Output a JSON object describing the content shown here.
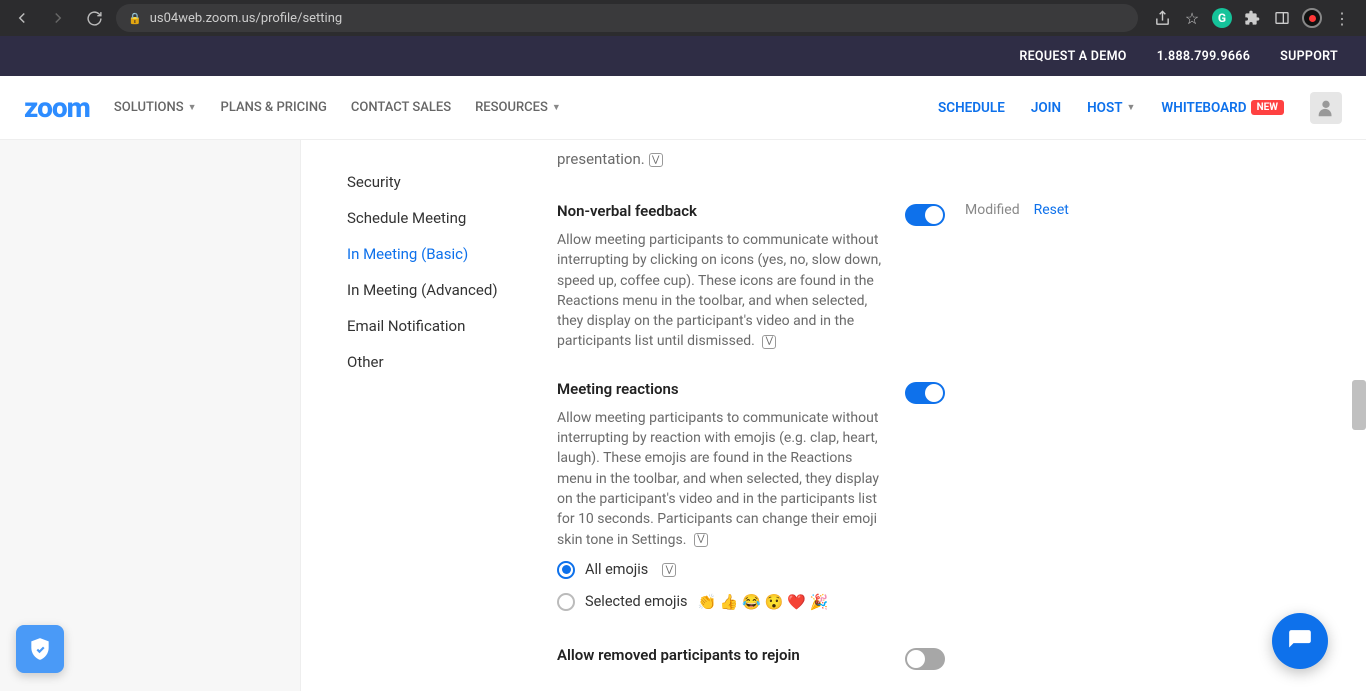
{
  "browser": {
    "url": "us04web.zoom.us/profile/setting"
  },
  "utilbar": {
    "demo": "REQUEST A DEMO",
    "phone": "1.888.799.9666",
    "support": "SUPPORT"
  },
  "header": {
    "logo": "zoom",
    "nav_left": {
      "solutions": "SOLUTIONS",
      "plans": "PLANS & PRICING",
      "contact": "CONTACT SALES",
      "resources": "RESOURCES"
    },
    "nav_right": {
      "schedule": "SCHEDULE",
      "join": "JOIN",
      "host": "HOST",
      "whiteboard": "WHITEBOARD",
      "new_badge": "NEW"
    }
  },
  "sidenav": {
    "items": [
      "Security",
      "Schedule Meeting",
      "In Meeting (Basic)",
      "In Meeting (Advanced)",
      "Email Notification",
      "Other"
    ]
  },
  "settings": {
    "cut_top": "presentation.",
    "nonverbal": {
      "title": "Non-verbal feedback",
      "desc": "Allow meeting participants to communicate without interrupting by clicking on icons (yes, no, slow down, speed up, coffee cup). These icons are found in the Reactions menu in the toolbar, and when selected, they display on the participant's video and in the participants list until dismissed.",
      "modified": "Modified",
      "reset": "Reset"
    },
    "reactions": {
      "title": "Meeting reactions",
      "desc": "Allow meeting participants to communicate without interrupting by reaction with emojis (e.g. clap, heart, laugh). These emojis are found in the Reactions menu in the toolbar, and when selected, they display on the participant's video and in the participants list for 10 seconds. Participants can change their emoji skin tone in Settings.",
      "opt_all": "All emojis",
      "opt_selected": "Selected emojis",
      "emoji_list": "👏 👍 😂 😯 ❤️ 🎉"
    },
    "rejoin": {
      "title": "Allow removed participants to rejoin"
    }
  }
}
